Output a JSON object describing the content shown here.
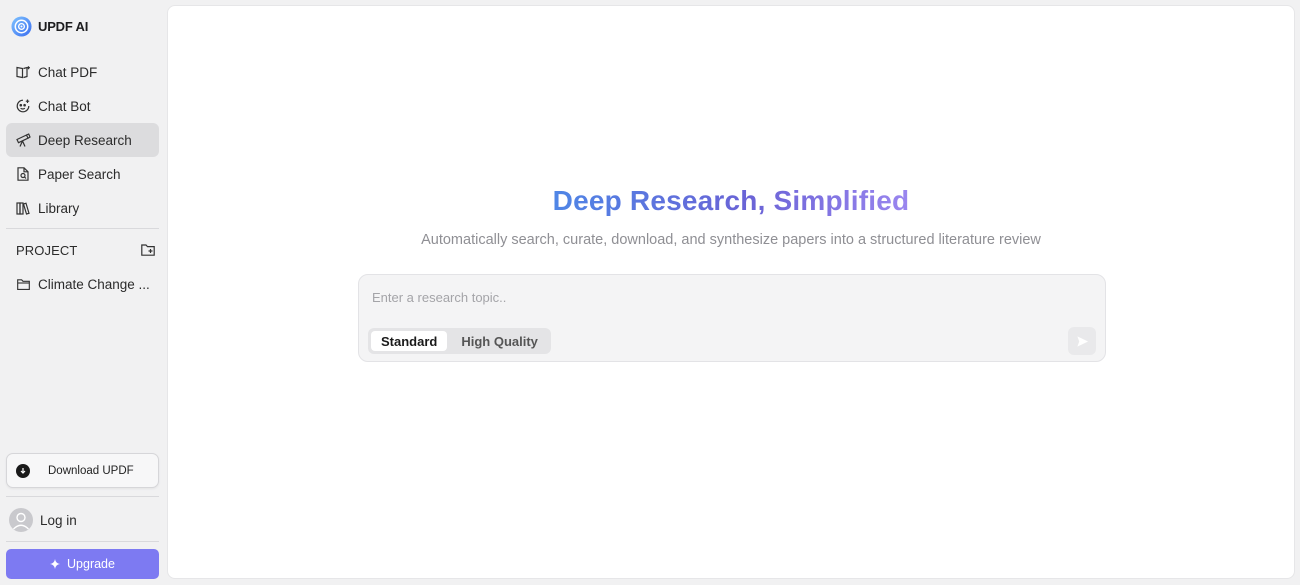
{
  "app": {
    "name": "UPDF AI"
  },
  "sidebar": {
    "items": [
      {
        "id": "chat-pdf",
        "label": "Chat PDF",
        "icon": "book-open-icon"
      },
      {
        "id": "chat-bot",
        "label": "Chat Bot",
        "icon": "bot-face-icon"
      },
      {
        "id": "deep-research",
        "label": "Deep Research",
        "icon": "telescope-icon",
        "active": true
      },
      {
        "id": "paper-search",
        "label": "Paper Search",
        "icon": "doc-search-icon"
      },
      {
        "id": "library",
        "label": "Library",
        "icon": "library-icon"
      }
    ],
    "project": {
      "header": "PROJECT",
      "items": [
        {
          "label": "Climate Change ..."
        }
      ]
    },
    "download_label": "Download UPDF",
    "login_label": "Log in",
    "upgrade_label": "Upgrade"
  },
  "main": {
    "title": "Deep Research, Simplified",
    "subtitle": "Automatically search, curate, download, and synthesize papers into a structured literature review",
    "search": {
      "placeholder": "Enter a research topic..",
      "value": ""
    },
    "modes": [
      {
        "label": "Standard",
        "selected": true
      },
      {
        "label": "High Quality",
        "selected": false
      }
    ]
  },
  "colors": {
    "accent": "#7d7af2",
    "title_gradient_start": "#4f86e6",
    "title_gradient_end": "#9a86ef",
    "active_nav_bg": "#dcdcde"
  }
}
